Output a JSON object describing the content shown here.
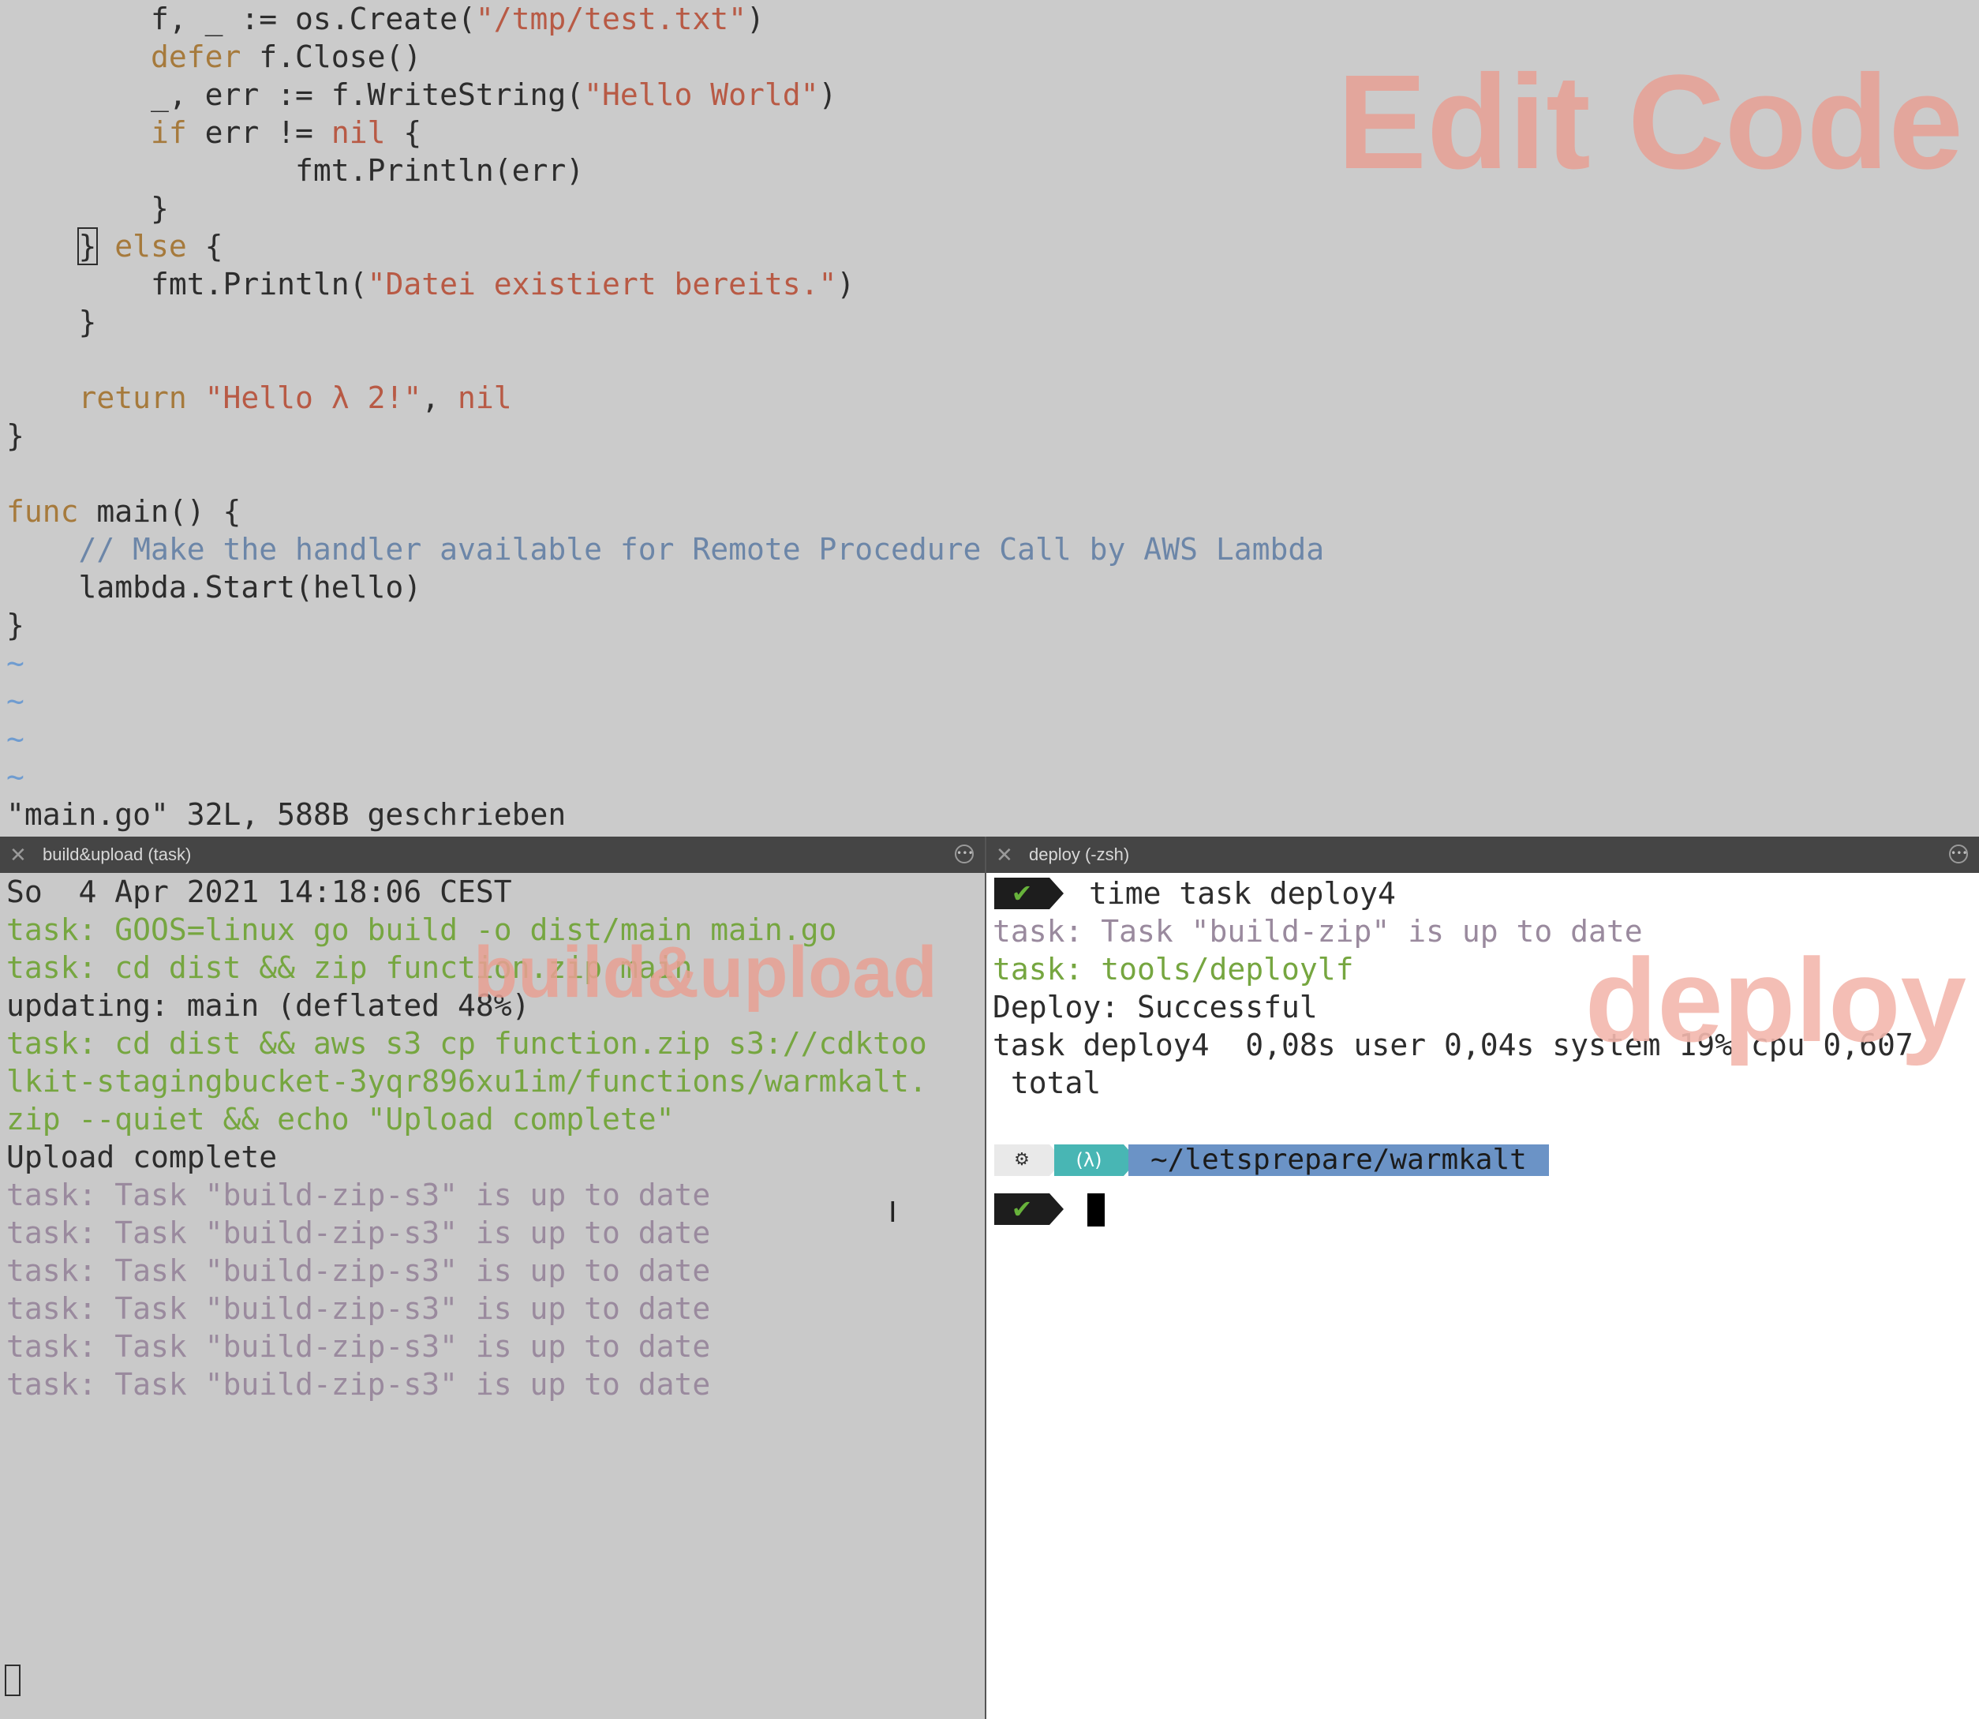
{
  "editor": {
    "watermark": "Edit Code",
    "lines": [
      {
        "segments": [
          [
            "d",
            "        f, _ := os.Create("
          ],
          [
            "s",
            "\"/tmp/test.txt\""
          ],
          [
            "d",
            ")"
          ]
        ]
      },
      {
        "segments": [
          [
            "k",
            "        defer"
          ],
          [
            "d",
            " f.Close()"
          ]
        ]
      },
      {
        "segments": [
          [
            "d",
            "        _, err := f.WriteString("
          ],
          [
            "s",
            "\"Hello World\""
          ],
          [
            "d",
            ")"
          ]
        ]
      },
      {
        "segments": [
          [
            "k",
            "        if"
          ],
          [
            "d",
            " err != "
          ],
          [
            "s",
            "nil"
          ],
          [
            "d",
            " {"
          ]
        ]
      },
      {
        "segments": [
          [
            "d",
            "                fmt.Println(err)"
          ]
        ]
      },
      {
        "segments": [
          [
            "d",
            "        }"
          ]
        ]
      },
      {
        "segments": [
          [
            "d",
            "    "
          ],
          [
            "cursor",
            "}"
          ],
          [
            "k",
            " else"
          ],
          [
            "d",
            " {"
          ]
        ]
      },
      {
        "segments": [
          [
            "d",
            "        fmt.Println("
          ],
          [
            "s",
            "\"Datei existiert bereits.\""
          ],
          [
            "d",
            ")"
          ]
        ]
      },
      {
        "segments": [
          [
            "d",
            "    }"
          ]
        ]
      },
      {
        "segments": [
          [
            "d",
            ""
          ]
        ]
      },
      {
        "segments": [
          [
            "k",
            "    return "
          ],
          [
            "s",
            "\"Hello λ 2!\""
          ],
          [
            "d",
            ", "
          ],
          [
            "s",
            "nil"
          ]
        ]
      },
      {
        "segments": [
          [
            "d",
            "}"
          ]
        ]
      },
      {
        "segments": [
          [
            "d",
            ""
          ]
        ]
      },
      {
        "segments": [
          [
            "k",
            "func"
          ],
          [
            "d",
            " main() {"
          ]
        ]
      },
      {
        "segments": [
          [
            "c",
            "    // Make the handler available for Remote Procedure Call by AWS Lambda"
          ]
        ]
      },
      {
        "segments": [
          [
            "d",
            "    lambda.Start(hello)"
          ]
        ]
      },
      {
        "segments": [
          [
            "d",
            "}"
          ]
        ]
      },
      {
        "segments": [
          [
            "t",
            "~"
          ]
        ]
      },
      {
        "segments": [
          [
            "t",
            "~"
          ]
        ]
      },
      {
        "segments": [
          [
            "t",
            "~"
          ]
        ]
      },
      {
        "segments": [
          [
            "t",
            "~"
          ]
        ]
      },
      {
        "segments": [
          [
            "d",
            "\"main.go\" 32L, 588B geschrieben"
          ]
        ]
      }
    ]
  },
  "left_pane": {
    "tab_title": "build&upload (task)",
    "watermark": "build&upload",
    "lines": [
      [
        "n",
        "So  4 Apr 2021 14:18:06 CEST"
      ],
      [
        "g",
        "task: GOOS=linux go build -o dist/main main.go"
      ],
      [
        "g",
        "task: cd dist && zip function.zip main"
      ],
      [
        "n",
        "updating: main (deflated 48%)"
      ],
      [
        "g",
        "task: cd dist && aws s3 cp function.zip s3://cdktoo"
      ],
      [
        "g",
        "lkit-stagingbucket-3yqr896xu1im/functions/warmkalt."
      ],
      [
        "g",
        "zip --quiet && echo \"Upload complete\""
      ],
      [
        "n",
        "Upload complete"
      ],
      [
        "p",
        "task: Task \"build-zip-s3\" is up to date"
      ],
      [
        "p",
        "task: Task \"build-zip-s3\" is up to date"
      ],
      [
        "p",
        "task: Task \"build-zip-s3\" is up to date"
      ],
      [
        "p",
        "task: Task \"build-zip-s3\" is up to date"
      ],
      [
        "p",
        "task: Task \"build-zip-s3\" is up to date"
      ],
      [
        "p",
        "task: Task \"build-zip-s3\" is up to date"
      ]
    ]
  },
  "right_pane": {
    "tab_title": "deploy (-zsh)",
    "watermark": "deploy",
    "check_symbol": "✔",
    "command": "time task deploy4",
    "lines": [
      [
        "p",
        "task: Task \"build-zip\" is up to date"
      ],
      [
        "g",
        "task: tools/deploylf"
      ],
      [
        "n",
        "Deploy: Successful"
      ],
      [
        "n",
        "task deploy4  0,08s user 0,04s system 19% cpu 0,607"
      ],
      [
        "n",
        " total"
      ]
    ],
    "prompt_path": "~/letsprepare/warmkalt"
  }
}
